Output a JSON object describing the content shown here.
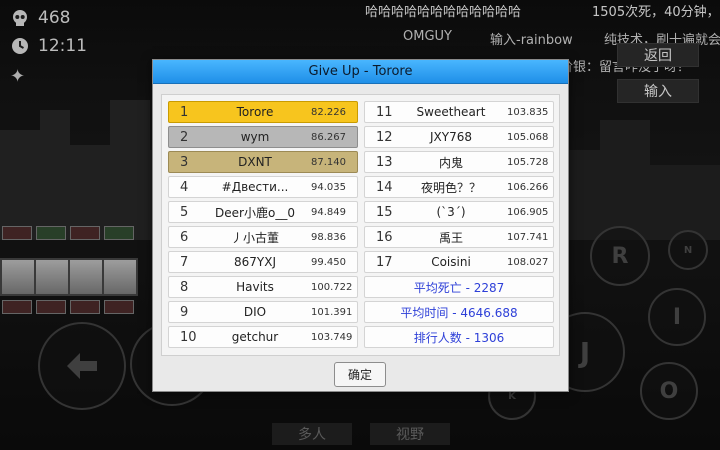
{
  "hud": {
    "deaths": "468",
    "time": "12:11"
  },
  "chat": {
    "line1_a": "哈哈哈哈哈哈哈哈哈哈哈哈",
    "line1_b": "1505次死，40分钟，",
    "line2_a": "OMGUY",
    "line2_b": "输入-rainbow",
    "line2_c": "纯技术，刷十遍就会",
    "line3": "阶银：留言咋没了呀？"
  },
  "side": {
    "back_label": "返回",
    "input_label": "输入"
  },
  "controls": {
    "r": "R",
    "n": "N",
    "i": "I",
    "j": "J",
    "o": "O",
    "k": "K"
  },
  "bottom": {
    "multi_label": "多人",
    "view_label": "视野"
  },
  "dialog": {
    "title": "Give Up - Torore",
    "ok_label": "确定",
    "left": [
      {
        "rank": "1",
        "name": "Torore",
        "score": "82.226"
      },
      {
        "rank": "2",
        "name": "wym",
        "score": "86.267"
      },
      {
        "rank": "3",
        "name": "DXNT",
        "score": "87.140"
      },
      {
        "rank": "4",
        "name": "#Двести...",
        "score": "94.035"
      },
      {
        "rank": "5",
        "name": "Deer小鹿o__0",
        "score": "94.849"
      },
      {
        "rank": "6",
        "name": "丿小古董",
        "score": "98.836"
      },
      {
        "rank": "7",
        "name": "867YXJ",
        "score": "99.450"
      },
      {
        "rank": "8",
        "name": "Havits",
        "score": "100.722"
      },
      {
        "rank": "9",
        "name": "DIO",
        "score": "101.391"
      },
      {
        "rank": "10",
        "name": "getchur",
        "score": "103.749"
      }
    ],
    "right": [
      {
        "rank": "11",
        "name": "Sweetheart",
        "score": "103.835"
      },
      {
        "rank": "12",
        "name": "JXY768",
        "score": "105.068"
      },
      {
        "rank": "13",
        "name": "内鬼",
        "score": "105.728"
      },
      {
        "rank": "14",
        "name": "夜明色？？",
        "score": "106.266"
      },
      {
        "rank": "15",
        "name": "(`3´)",
        "score": "106.905"
      },
      {
        "rank": "16",
        "name": "禹王",
        "score": "107.741"
      },
      {
        "rank": "17",
        "name": "Coisini",
        "score": "108.027"
      }
    ],
    "stats": {
      "avg_deaths": "平均死亡 - 2287",
      "avg_time": "平均时间 - 4646.688",
      "rank_count": "排行人数 - 1306"
    }
  },
  "colors": {
    "title_bar": "#1f8fe8",
    "gold": "#f7c51e",
    "silver": "#b7b7b7",
    "bronze": "#c7b47a",
    "stat_text": "#2d3fd8"
  },
  "icons": [
    "skull-icon",
    "clock-icon",
    "sparkle-icon",
    "back-arrow-icon"
  ]
}
